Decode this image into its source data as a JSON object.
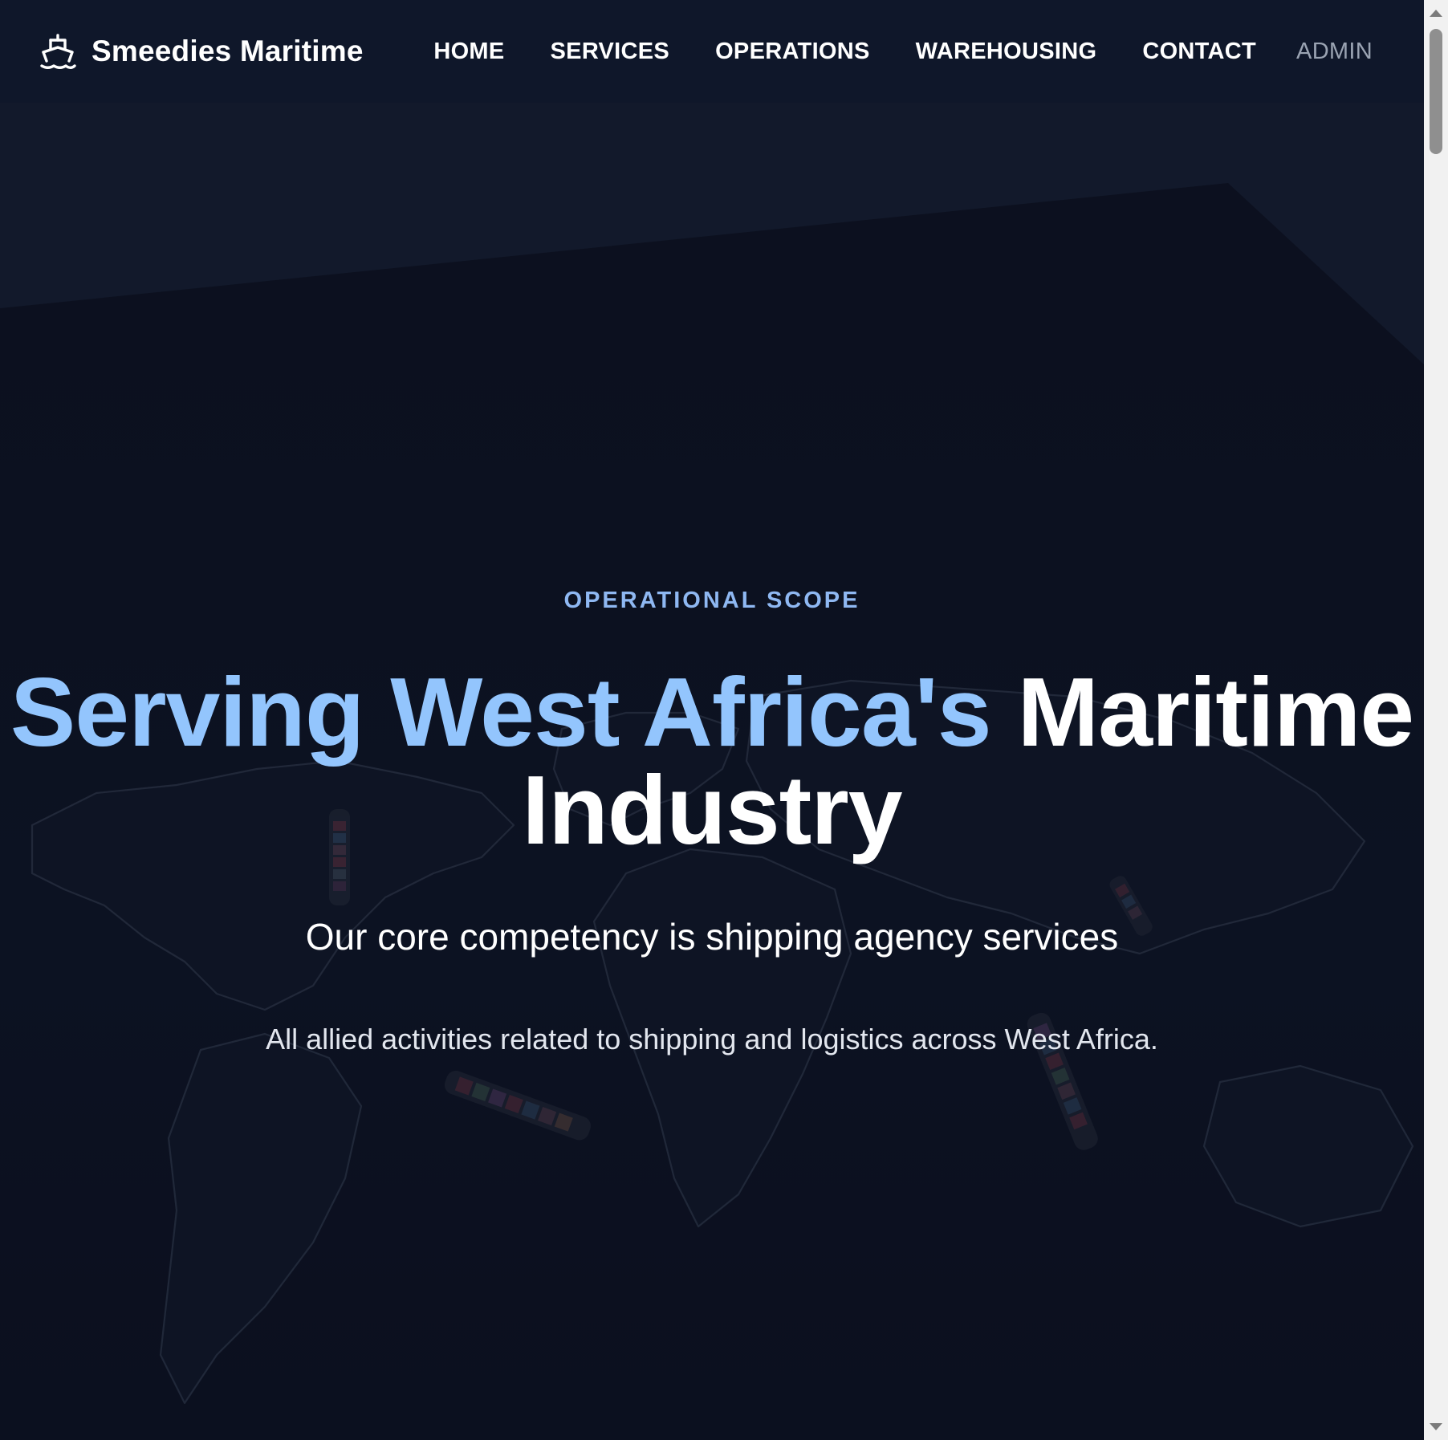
{
  "brand": {
    "name": "Smeedies Maritime",
    "icon": "ship-icon"
  },
  "nav": {
    "items": [
      {
        "label": "HOME"
      },
      {
        "label": "SERVICES"
      },
      {
        "label": "OPERATIONS"
      },
      {
        "label": "WAREHOUSING"
      },
      {
        "label": "CONTACT"
      }
    ],
    "admin_label": "ADMIN"
  },
  "hero": {
    "eyebrow": "OPERATIONAL SCOPE",
    "headline_accent": "Serving West Africa's",
    "headline_plain_1": "Maritime",
    "headline_plain_2": "Industry",
    "subheadline": "Our core competency is shipping agency services",
    "description": "All allied activities related to shipping and logistics across West Africa.",
    "background": "world-map-with-container-ships"
  },
  "colors": {
    "nav_background": "#0f172a",
    "accent": "#93c5fd",
    "eyebrow": "#8fb8f2",
    "hero_background": "#0c1222",
    "admin_link": "#9aa3b2"
  }
}
